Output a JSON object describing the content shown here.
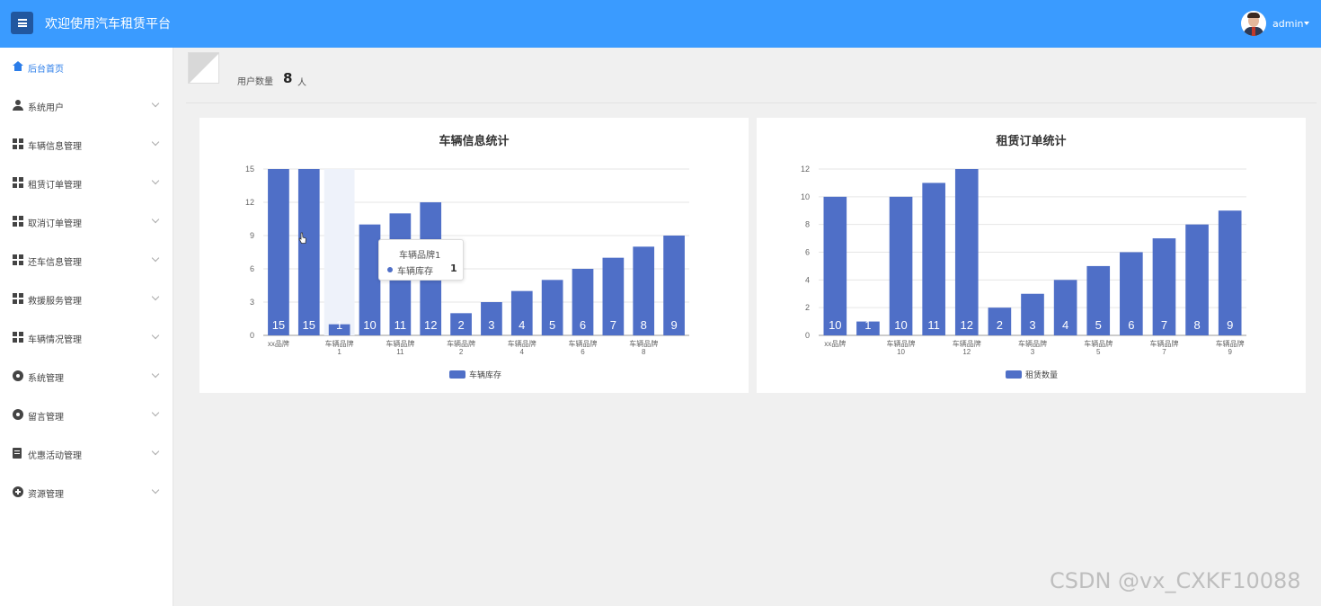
{
  "header": {
    "title": "欢迎使用汽车租赁平台",
    "user": "admin"
  },
  "sidebar": {
    "items": [
      {
        "label": "后台首页",
        "icon": "home-icon",
        "active": true
      },
      {
        "label": "系统用户",
        "icon": "user-icon"
      },
      {
        "label": "车辆信息管理",
        "icon": "grid-icon"
      },
      {
        "label": "租赁订单管理",
        "icon": "grid-icon"
      },
      {
        "label": "取消订单管理",
        "icon": "grid-icon"
      },
      {
        "label": "还车信息管理",
        "icon": "grid-icon"
      },
      {
        "label": "救援服务管理",
        "icon": "grid-icon"
      },
      {
        "label": "车辆情况管理",
        "icon": "grid-icon"
      },
      {
        "label": "系统管理",
        "icon": "gear-icon"
      },
      {
        "label": "留言管理",
        "icon": "gear-icon"
      },
      {
        "label": "优惠活动管理",
        "icon": "document-icon"
      },
      {
        "label": "资源管理",
        "icon": "plus-circle-icon"
      }
    ]
  },
  "stats": {
    "label": "用户数量",
    "value": "8",
    "unit": "人"
  },
  "colors": {
    "accent": "#3a9bff",
    "bar": "#4f6fc7",
    "active_nav": "#2b7de9"
  },
  "tooltip": {
    "title": "车辆品牌1",
    "series": "车辆库存",
    "value": "1"
  },
  "watermark": "CSDN @vx_CXKF10088",
  "chart_data": [
    {
      "type": "bar",
      "title": "车辆信息统计",
      "categories": [
        "xx品牌",
        "",
        "车辆品牌1",
        "",
        "车辆品牌11",
        "",
        "车辆品牌2",
        "",
        "车辆品牌4",
        "",
        "车辆品牌6",
        "",
        "车辆品牌8",
        ""
      ],
      "series": [
        {
          "name": "车辆库存",
          "values": [
            15,
            15,
            1,
            10,
            11,
            12,
            2,
            3,
            4,
            5,
            6,
            7,
            8,
            9
          ]
        }
      ],
      "ylim": [
        0,
        15
      ],
      "yticks": [
        0,
        3,
        6,
        9,
        12,
        15
      ],
      "legend": "bottom-center",
      "grid": true
    },
    {
      "type": "bar",
      "title": "租赁订单统计",
      "categories": [
        "xx品牌",
        "",
        "车辆品牌10",
        "",
        "车辆品牌12",
        "",
        "车辆品牌3",
        "",
        "车辆品牌5",
        "",
        "车辆品牌7",
        "",
        "车辆品牌9"
      ],
      "series": [
        {
          "name": "租赁数量",
          "values": [
            10,
            1,
            10,
            11,
            12,
            2,
            3,
            4,
            5,
            6,
            7,
            8,
            9
          ]
        }
      ],
      "ylim": [
        0,
        12
      ],
      "yticks": [
        0,
        2,
        4,
        6,
        8,
        10,
        12
      ],
      "legend": "bottom-center",
      "grid": true
    }
  ]
}
